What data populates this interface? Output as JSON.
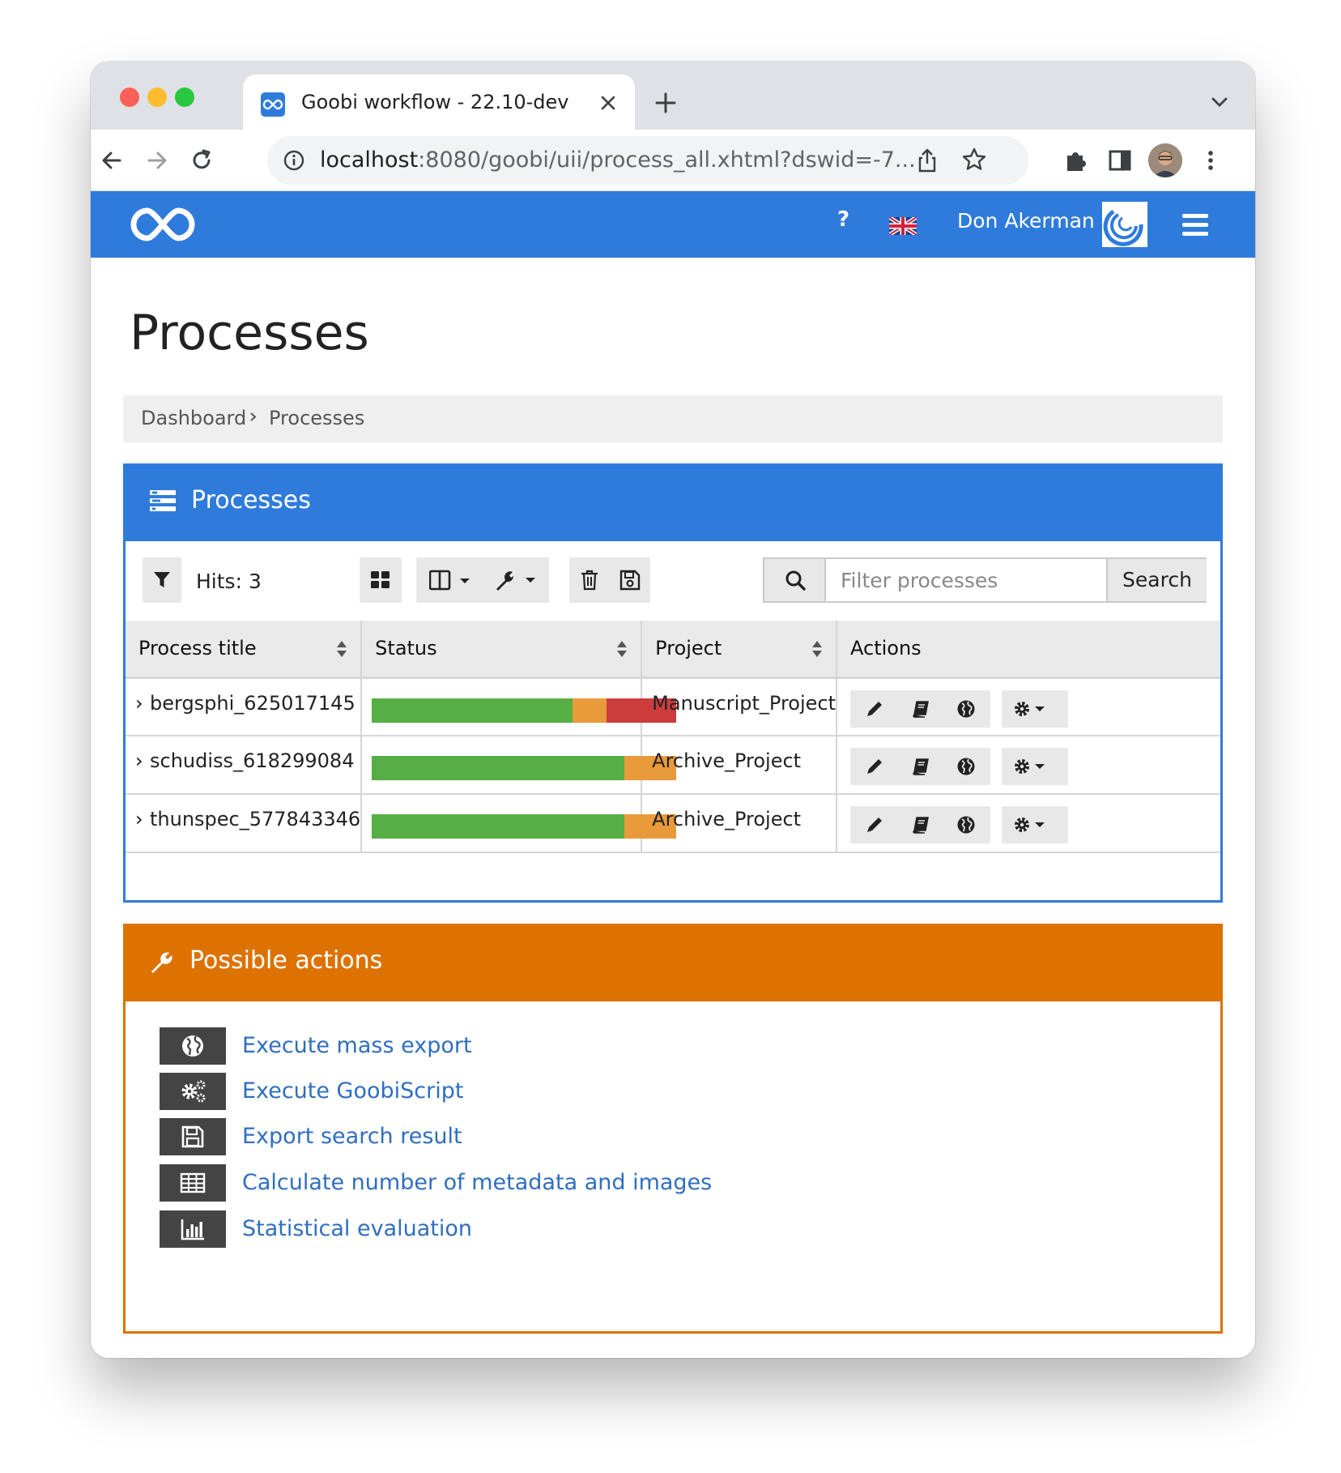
{
  "browser": {
    "tab_title": "Goobi workflow - 22.10-dev",
    "url_host": "localhost",
    "url_rest": ":8080/goobi/uii/process_all.xhtml?dswid=-7..."
  },
  "header": {
    "help_label": "?",
    "user_name": "Don Akerman"
  },
  "page": {
    "title": "Processes",
    "breadcrumb": [
      "Dashboard",
      "Processes"
    ]
  },
  "processes_box": {
    "title": "Processes",
    "hits_label": "Hits: 3",
    "search": {
      "placeholder": "Filter processes",
      "button_label": "Search"
    },
    "columns": [
      "Process title",
      "Status",
      "Project",
      "Actions"
    ],
    "rows": [
      {
        "title": "bergsphi_625017145",
        "project": "Manuscript_Project",
        "status": {
          "done": 0.66,
          "open": 0.11,
          "error": 0.23
        }
      },
      {
        "title": "schudiss_618299084",
        "project": "Archive_Project",
        "status": {
          "done": 0.83,
          "open": 0.17,
          "error": 0
        }
      },
      {
        "title": "thunspec_577843346",
        "project": "Archive_Project",
        "status": {
          "done": 0.83,
          "open": 0.17,
          "error": 0
        }
      }
    ]
  },
  "actions_box": {
    "title": "Possible actions",
    "items": [
      {
        "icon": "globe-icon",
        "label": "Execute mass export"
      },
      {
        "icon": "gears-icon",
        "label": "Execute GoobiScript"
      },
      {
        "icon": "save-icon",
        "label": "Export search result"
      },
      {
        "icon": "table-icon",
        "label": "Calculate number of metadata and images"
      },
      {
        "icon": "bar-chart-icon",
        "label": "Statistical evaluation"
      }
    ]
  },
  "colors": {
    "primary": "#2f7bdc",
    "actions": "#dd7200",
    "status_done": "#56ae45",
    "status_open": "#e99a3a",
    "status_error": "#cc3c3c"
  }
}
